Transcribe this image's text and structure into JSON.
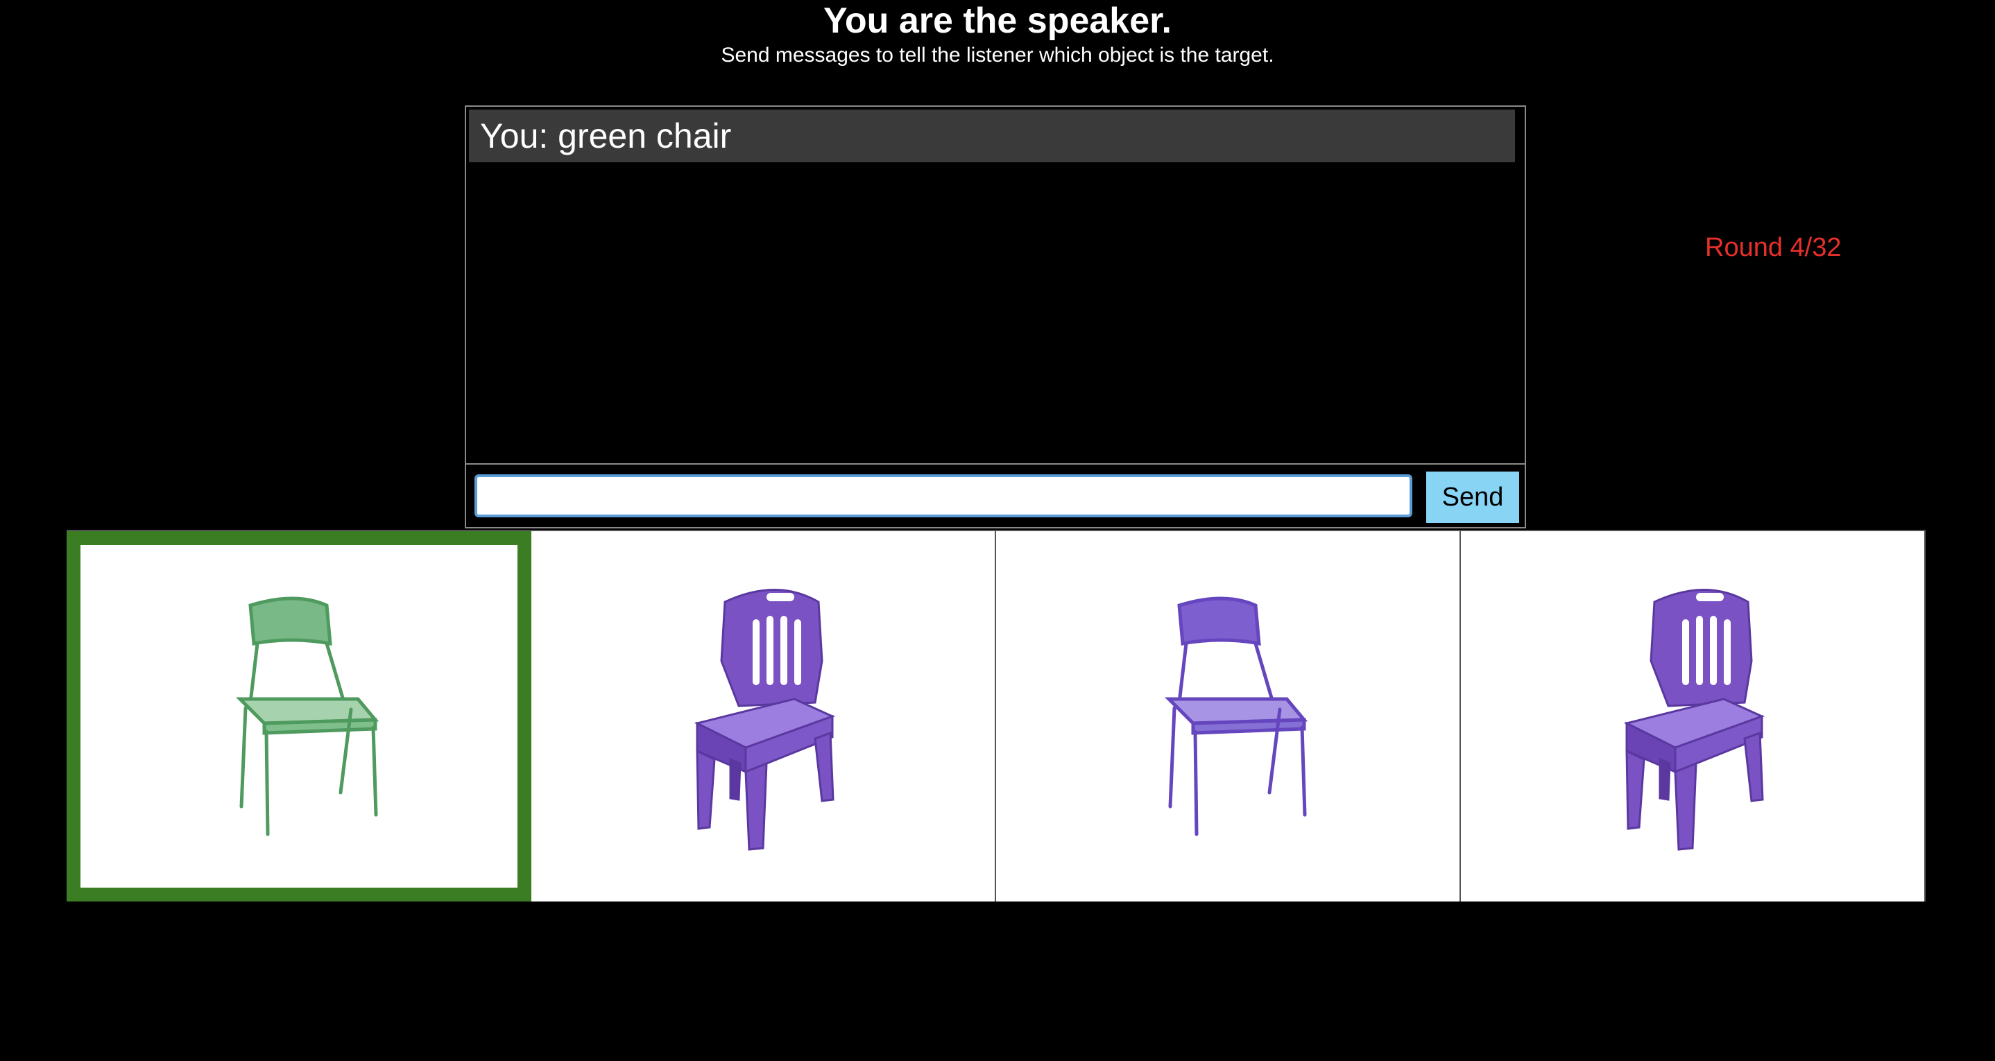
{
  "header": {
    "title": "You are the speaker.",
    "subtitle": "Send messages to tell the listener which object is the target."
  },
  "round": {
    "label": "Round 4/32"
  },
  "chat": {
    "messages": [
      {
        "text": "You: green chair"
      }
    ]
  },
  "input": {
    "value": "",
    "placeholder": ""
  },
  "send": {
    "label": "Send"
  },
  "objects": [
    {
      "name": "chair",
      "style": "metal-frame",
      "color": "#6fae7c",
      "target": true
    },
    {
      "name": "chair",
      "style": "plastic-molded",
      "color": "#7a52c4",
      "target": false
    },
    {
      "name": "chair",
      "style": "metal-frame",
      "color": "#7d5fd0",
      "target": false
    },
    {
      "name": "chair",
      "style": "plastic-molded",
      "color": "#7a52c4",
      "target": false
    }
  ],
  "colors": {
    "target_border": "#3a7d22",
    "round_text": "#e8302a",
    "send_button": "#87d4f5",
    "input_focus": "#5b9dd9"
  }
}
